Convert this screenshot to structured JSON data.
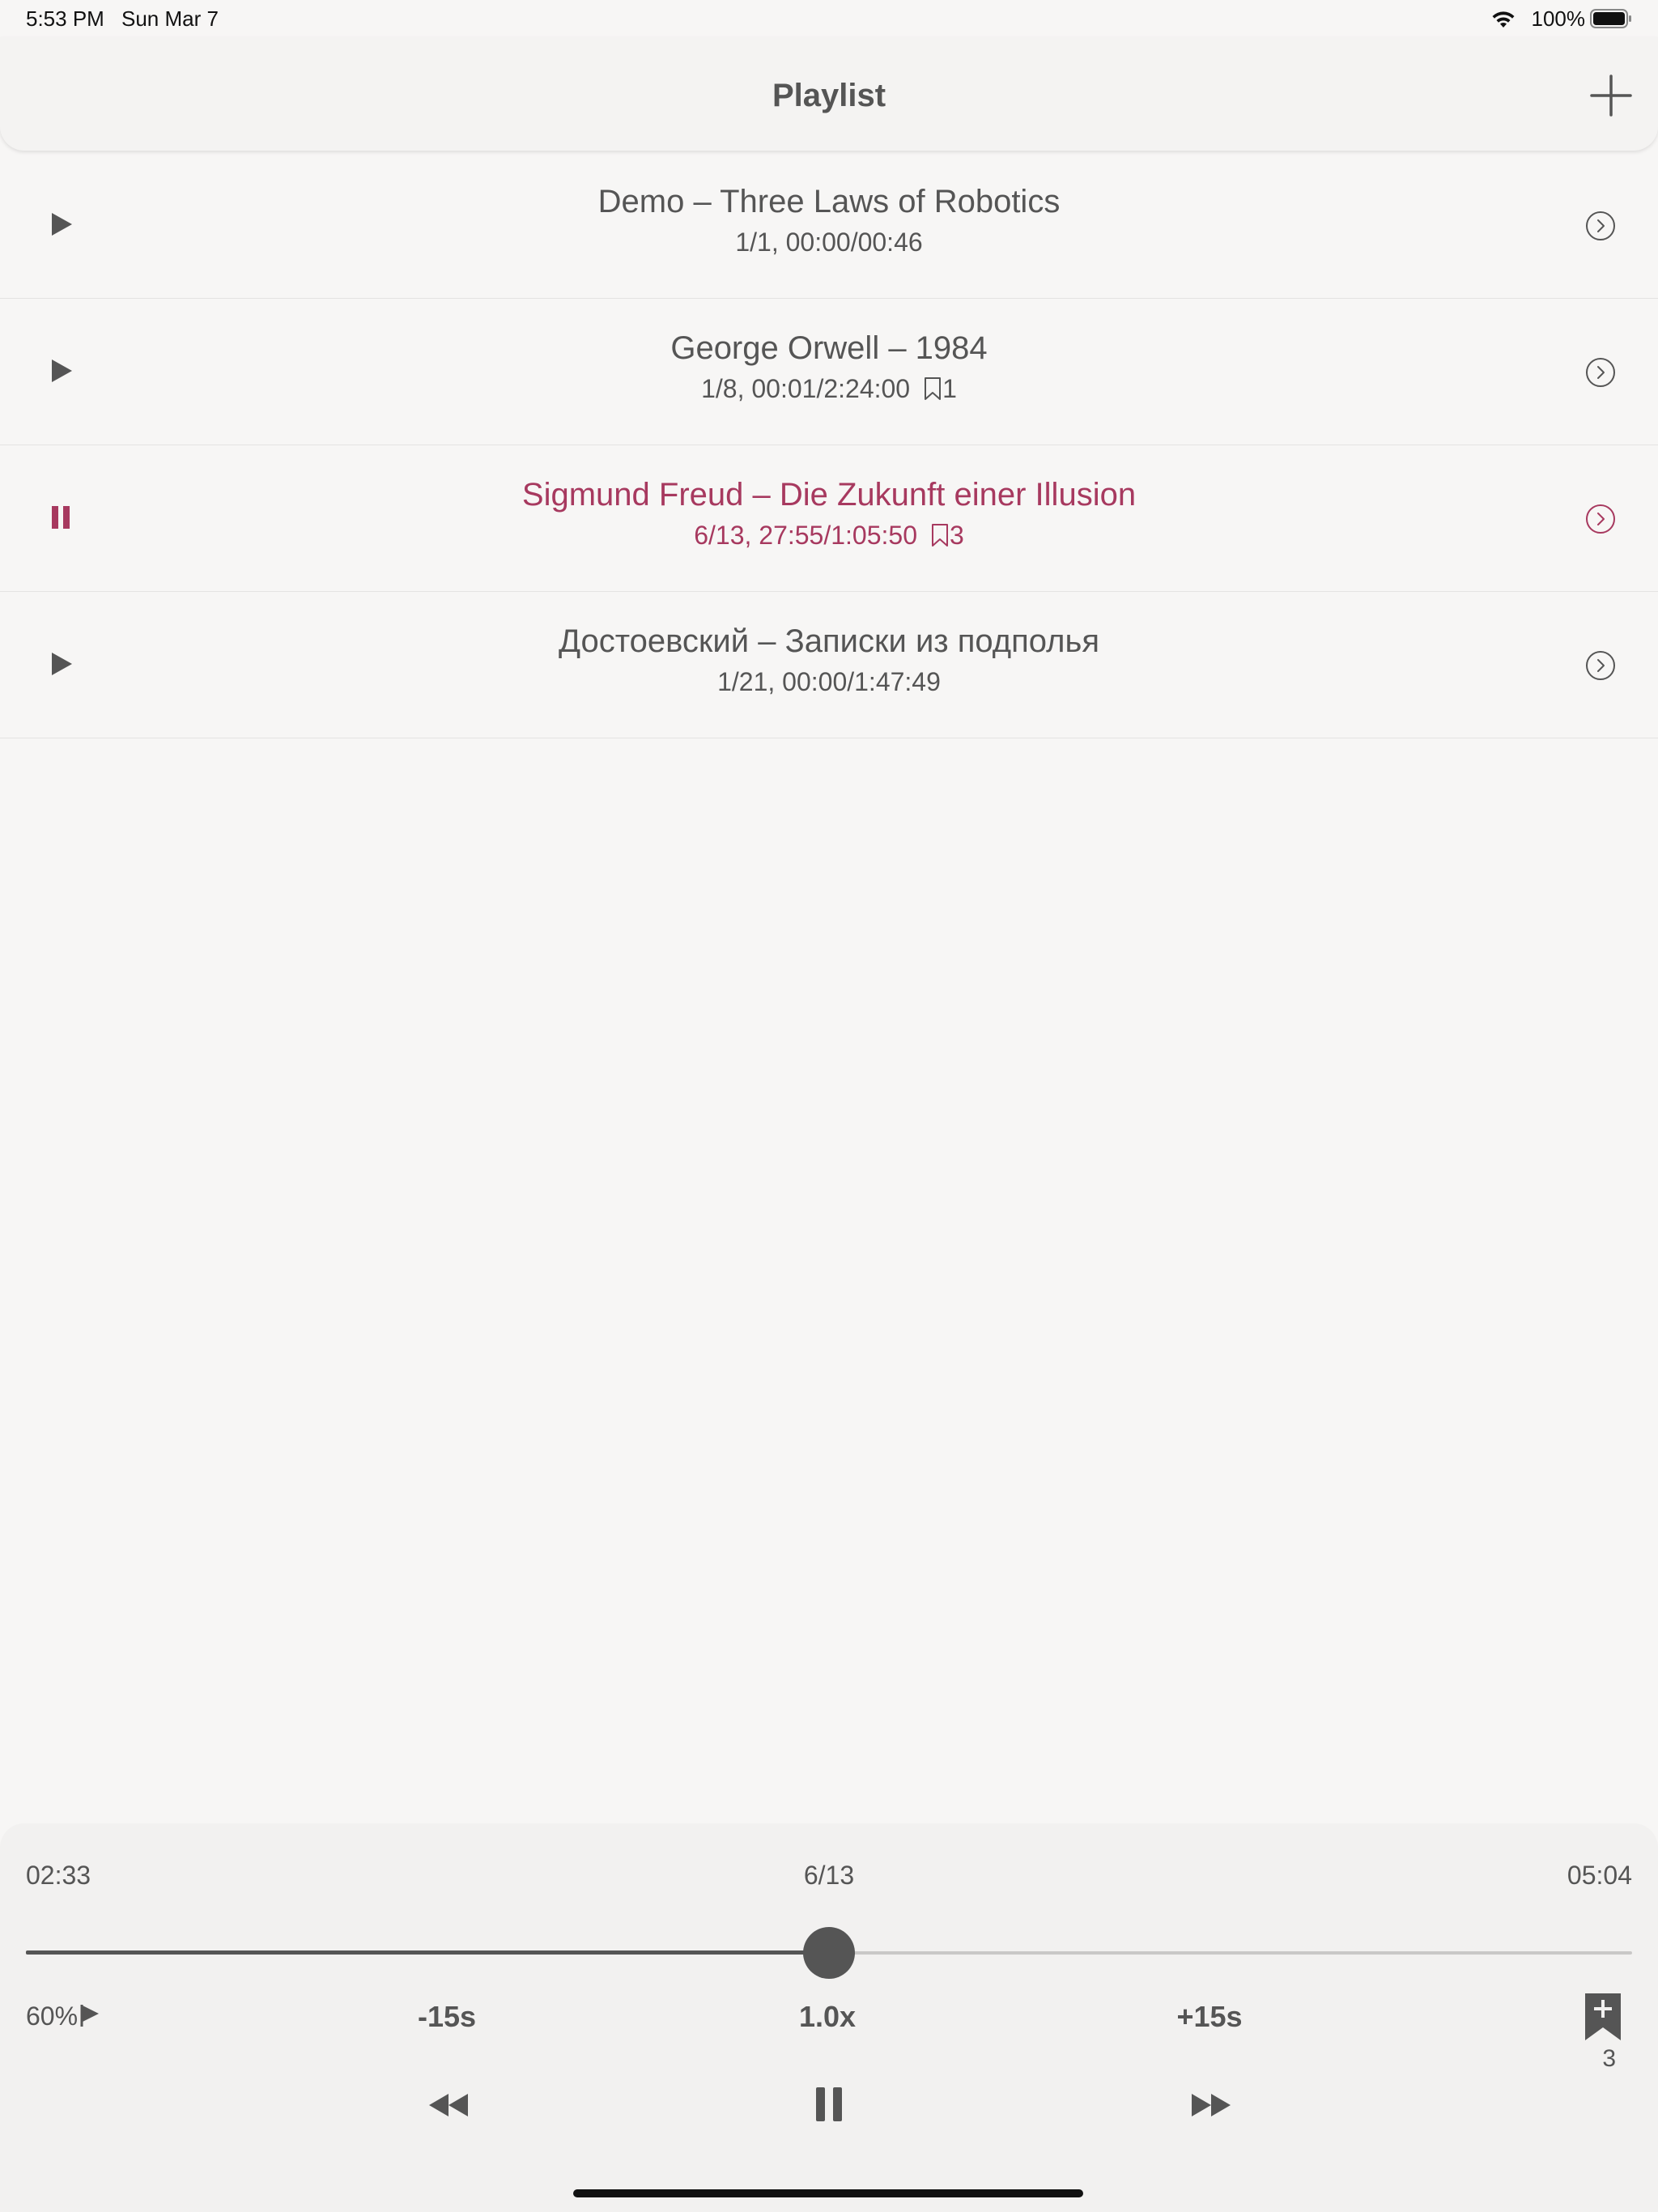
{
  "status_bar": {
    "time": "5:53 PM",
    "date": "Sun Mar 7",
    "battery": "100%"
  },
  "nav": {
    "title": "Playlist",
    "add_icon": "plus-icon"
  },
  "colors": {
    "accent": "#a7395f",
    "text": "#555555",
    "background": "#f7f6f5"
  },
  "tracks": [
    {
      "title": "Demo – Three Laws of Robotics",
      "info": "1/1, 00:00/00:46",
      "bookmarks": "",
      "state": "play"
    },
    {
      "title": "George Orwell – 1984",
      "info": "1/8, 00:01/2:24:00",
      "bookmarks": "1",
      "state": "play"
    },
    {
      "title": "Sigmund Freud – Die Zukunft einer Illusion",
      "info": "6/13, 27:55/1:05:50",
      "bookmarks": "3",
      "state": "pause"
    },
    {
      "title": "Достоевский – Записки из подполья",
      "info": "1/21, 00:00/1:47:49",
      "bookmarks": "",
      "state": "play"
    }
  ],
  "player": {
    "elapsed": "02:33",
    "chapter": "6/13",
    "remaining": "05:04",
    "progress": 0.5,
    "volume": "60%",
    "skip_back": "-15s",
    "speed": "1.0x",
    "skip_forward": "+15s",
    "bookmark_count": "3"
  }
}
